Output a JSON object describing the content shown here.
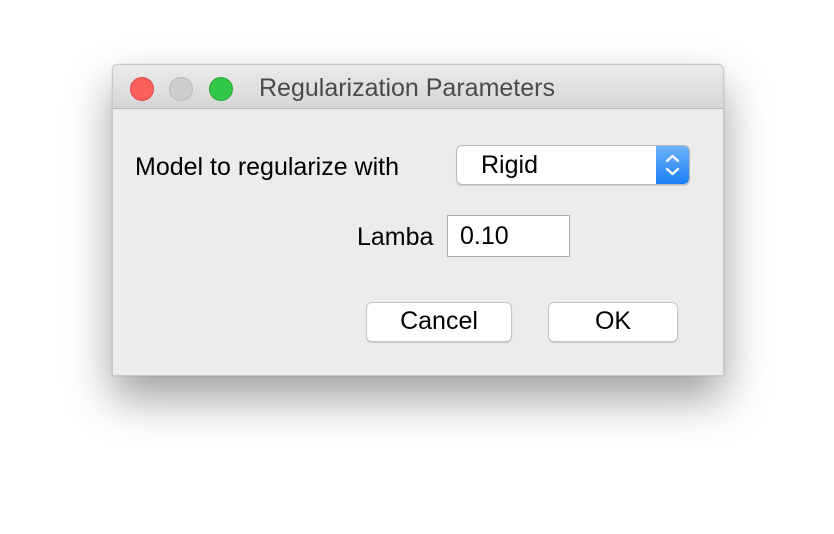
{
  "window": {
    "title": "Regularization Parameters"
  },
  "form": {
    "model_label": "Model to regularize with",
    "model_value": "Rigid",
    "lambda_label": "Lamba",
    "lambda_value": "0.10"
  },
  "buttons": {
    "cancel": "Cancel",
    "ok": "OK"
  },
  "colors": {
    "close": "#fc605c",
    "minimize": "#cdcdcd",
    "zoom": "#34c84a",
    "select_accent": "#1c7ff5"
  },
  "icons": {
    "window_close": "close-icon",
    "window_minimize": "minimize-icon",
    "window_zoom": "zoom-icon",
    "select_arrows": "updown-chevron-icon"
  }
}
